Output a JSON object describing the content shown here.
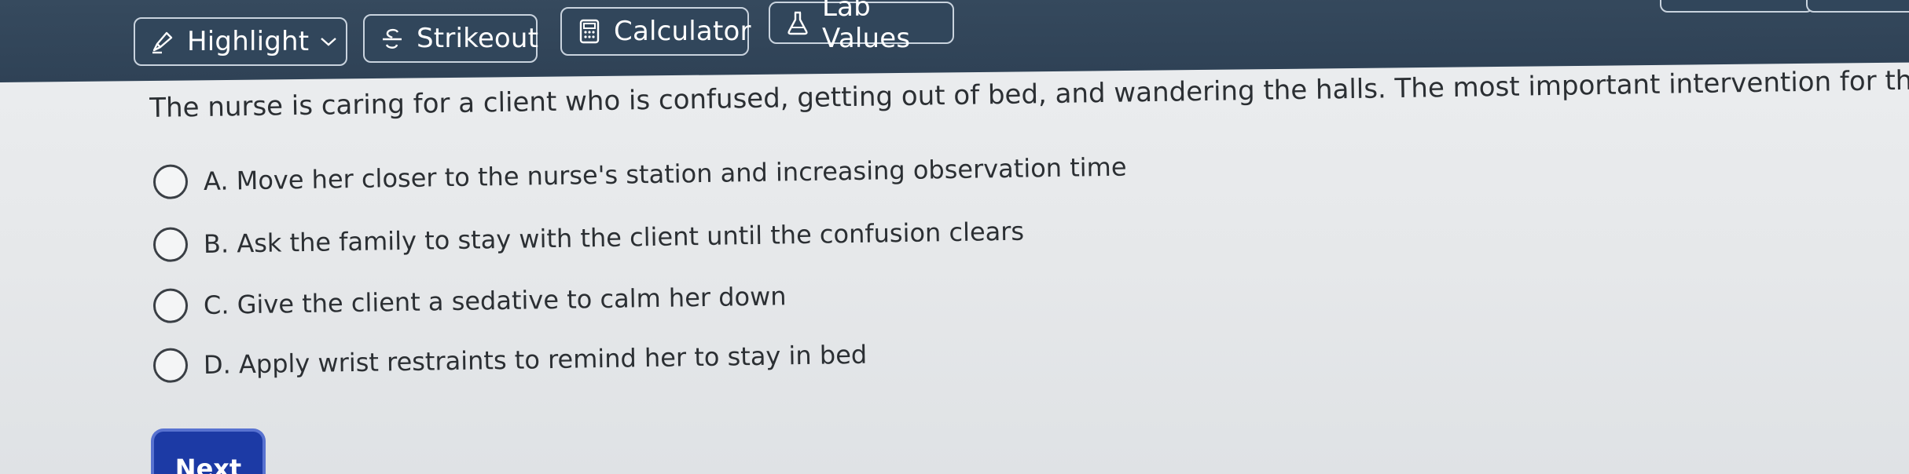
{
  "toolbar": {
    "highlight_label": "Highlight",
    "strikeout_label": "Strikeout",
    "calculator_label": "Calculator",
    "lab_values_label": "Lab Values"
  },
  "question": {
    "text": "The nurse is caring for a client who is confused, getting out of bed, and wandering the halls. The most important intervention for this client is to:",
    "options": [
      {
        "label": "A. Move her closer to the nurse's station and increasing observation time"
      },
      {
        "label": "B. Ask the family to stay with the client until the confusion clears"
      },
      {
        "label": "C. Give the client a sedative to calm her down"
      },
      {
        "label": "D. Apply wrist restraints to remind her to stay in bed"
      }
    ]
  },
  "navigation": {
    "next_label": "Next"
  },
  "icons": {
    "highlight": "highlighter-icon",
    "highlight_dropdown": "chevron-down-icon",
    "strikeout": "strikethrough-icon",
    "calculator": "calculator-icon",
    "lab_values": "flask-icon"
  },
  "colors": {
    "toolbar_bg": "#31465b",
    "button_border": "#c9d3de",
    "next_button": "#1c3aa5",
    "page_bg": "#e9ecef"
  }
}
